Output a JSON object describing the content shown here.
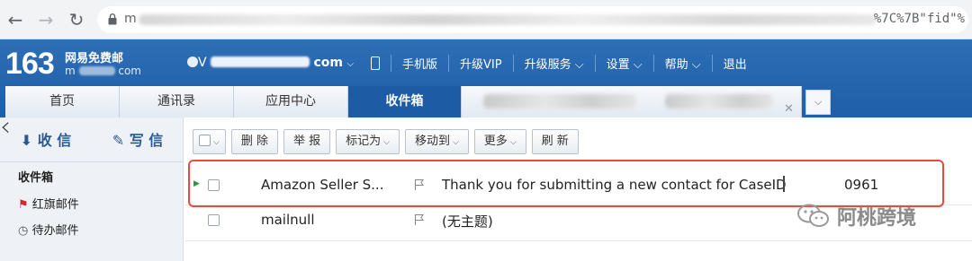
{
  "browser": {
    "url_prefix": "m",
    "url_tail": "%7C%7B\"fid\"%"
  },
  "header": {
    "logo_number": "163",
    "logo_cn": "网易免费邮",
    "logo_sub_prefix": "m",
    "logo_sub_suffix": "com",
    "account_prefix": "V",
    "account_suffix": "com",
    "nav": [
      "手机版",
      "升级VIP",
      "升级服务",
      "设置",
      "帮助",
      "退出"
    ]
  },
  "tabs": [
    {
      "label": "首页"
    },
    {
      "label": "通讯录"
    },
    {
      "label": "应用中心"
    },
    {
      "label": "收件箱",
      "active": true
    }
  ],
  "sidebar": {
    "receive_label": "收 信",
    "compose_label": "写 信",
    "items": [
      "收件箱",
      "红旗邮件",
      "待办邮件"
    ]
  },
  "toolbar": {
    "buttons": [
      "删 除",
      "举 报",
      "标记为",
      "移动到",
      "更多",
      "刷 新"
    ]
  },
  "emails": [
    {
      "sender": "Amazon Seller S...",
      "subject": "Thank you for submitting a new contact for CaseID",
      "subject_tail": "0961"
    },
    {
      "sender": "mailnull",
      "subject": "(无主题)"
    }
  ],
  "watermark": {
    "text": "阿桃跨境"
  },
  "colors": {
    "header_blue": "#1f5ea8",
    "highlight_red": "#e74c3c"
  }
}
